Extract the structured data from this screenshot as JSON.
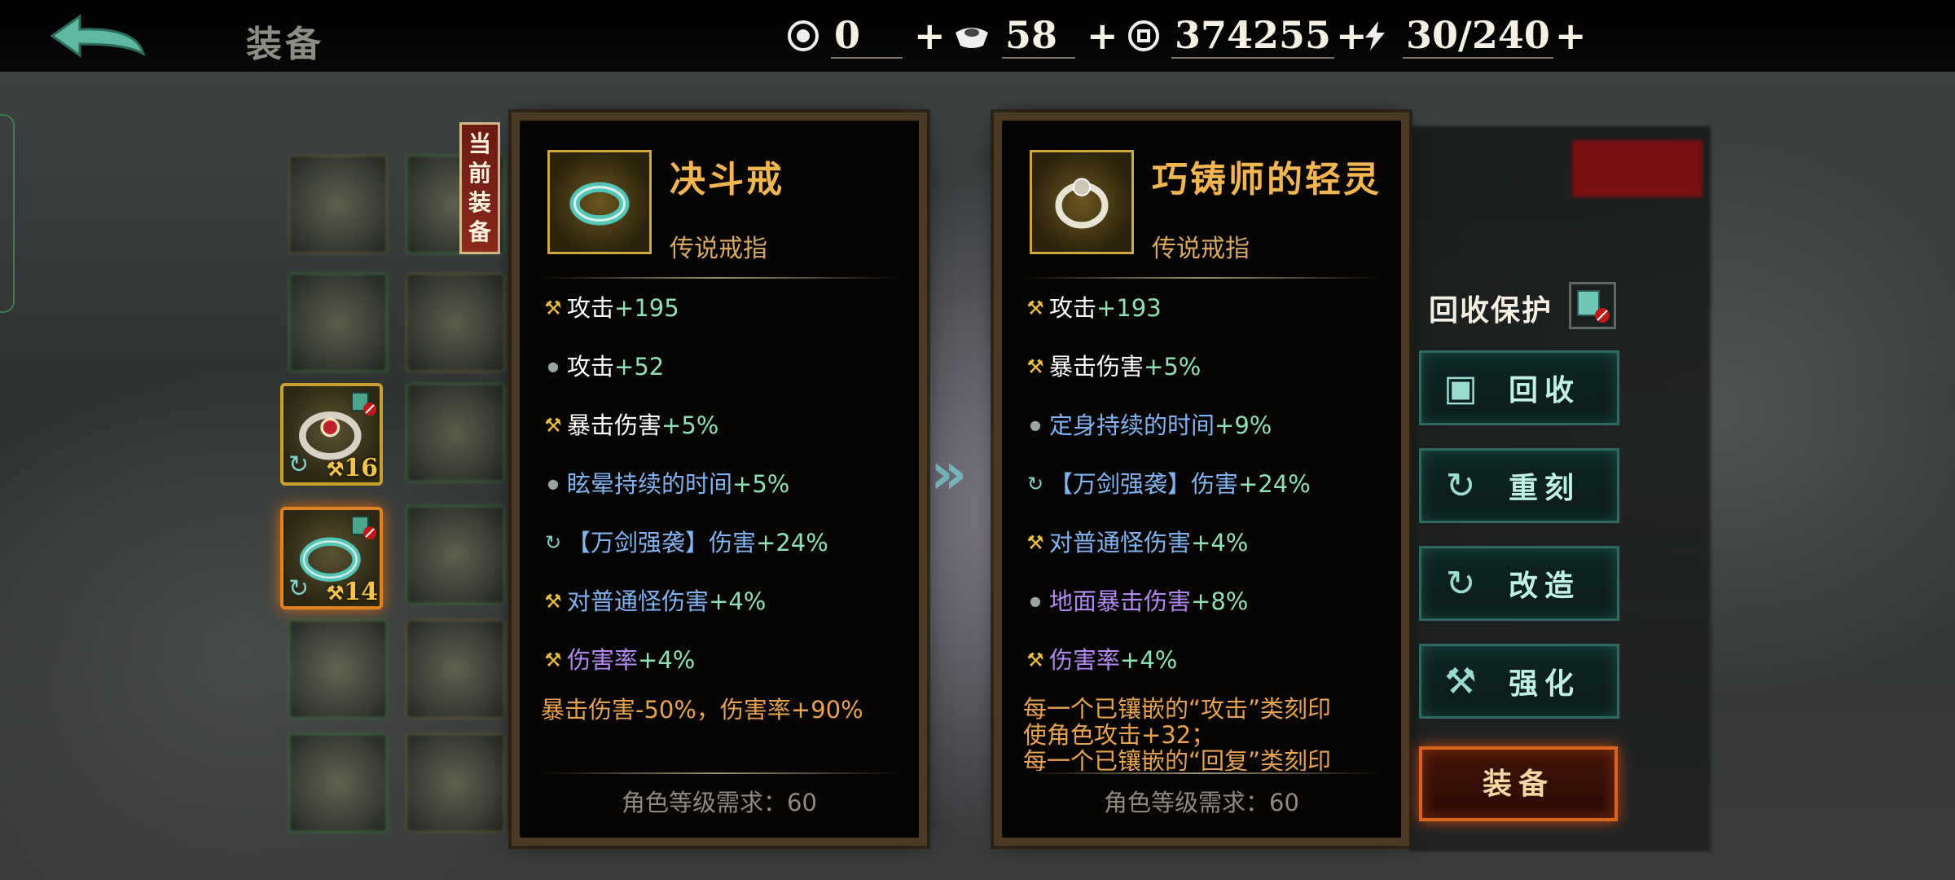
{
  "header": {
    "title": "装备",
    "currencies": [
      {
        "icon": "coupon-icon",
        "value": "0",
        "plus": "+"
      },
      {
        "icon": "silver-ingot-icon",
        "value": "58",
        "plus": "+"
      },
      {
        "icon": "coin-icon",
        "value": "374255",
        "plus": "+"
      },
      {
        "icon": "lightning-icon",
        "value": "30/240",
        "plus": "+"
      }
    ]
  },
  "slots": [
    {
      "level": "16",
      "selected": false
    },
    {
      "level": "14",
      "selected": true
    }
  ],
  "current_tag": "当前装备",
  "current_item": {
    "name": "决斗戒",
    "type": "传说戒指",
    "stats": [
      {
        "marker": "hammer",
        "label": "攻击",
        "value": "+195",
        "label_color": "#ffffff",
        "value_color": "#8fe1b3"
      },
      {
        "marker": "dot",
        "label": "攻击",
        "value": "+52",
        "label_color": "#ffffff",
        "value_color": "#8fe1b3"
      },
      {
        "marker": "hammer",
        "label": "暴击伤害",
        "value": "+5%",
        "label_color": "#ffffff",
        "value_color": "#8fe1b3"
      },
      {
        "marker": "dot",
        "label": "眩晕持续的时间",
        "value": "+5%",
        "label_color": "#7fb3f2",
        "value_color": "#8fe1b3"
      },
      {
        "marker": "cycle",
        "label": "【万剑强袭】伤害",
        "value": "+24%",
        "label_color": "#7fb3f2",
        "value_color": "#8fe1b3"
      },
      {
        "marker": "hammer",
        "label": "对普通怪伤害",
        "value": "+4%",
        "label_color": "#7fb3f2",
        "value_color": "#8fe1b3"
      },
      {
        "marker": "hammer",
        "label": "伤害率",
        "value": "+4%",
        "label_color": "#b08af0",
        "value_color": "#8fe1b3"
      }
    ],
    "note": "暴击伤害-50%，伤害率+90%",
    "requirement": "角色等级需求：60"
  },
  "new_item": {
    "name": "巧铸师的轻灵",
    "type": "传说戒指",
    "stats": [
      {
        "marker": "hammer",
        "label": "攻击",
        "value": "+193",
        "label_color": "#ffffff",
        "value_color": "#8fe1b3"
      },
      {
        "marker": "hammer",
        "label": "暴击伤害",
        "value": "+5%",
        "label_color": "#ffffff",
        "value_color": "#8fe1b3"
      },
      {
        "marker": "dot",
        "label": "定身持续的时间",
        "value": "+9%",
        "label_color": "#7fb3f2",
        "value_color": "#8fe1b3"
      },
      {
        "marker": "cycle",
        "label": "【万剑强袭】伤害",
        "value": "+24%",
        "label_color": "#7fb3f2",
        "value_color": "#8fe1b3"
      },
      {
        "marker": "hammer",
        "label": "对普通怪伤害",
        "value": "+4%",
        "label_color": "#7fb3f2",
        "value_color": "#8fe1b3"
      },
      {
        "marker": "dot",
        "label": "地面暴击伤害",
        "value": "+8%",
        "label_color": "#b08af0",
        "value_color": "#8fe1b3"
      },
      {
        "marker": "hammer",
        "label": "伤害率",
        "value": "+4%",
        "label_color": "#b08af0",
        "value_color": "#8fe1b3"
      }
    ],
    "note_lines": [
      "每一个已镶嵌的“攻击”类刻印",
      "使角色攻击+32；",
      "每一个已镶嵌的“回复”类刻印"
    ],
    "requirement": "角色等级需求：60"
  },
  "actions": {
    "protect_label": "回收保护",
    "buttons": [
      {
        "id": "recycle",
        "icon": "recycle-box-icon",
        "label": "回收"
      },
      {
        "id": "reforge",
        "icon": "refresh-icon",
        "label": "重刻"
      },
      {
        "id": "modify",
        "icon": "refresh-icon",
        "label": "改造"
      },
      {
        "id": "enhance",
        "icon": "hammer-icon",
        "label": "强化"
      }
    ],
    "equip_label": "装备"
  },
  "colors": {
    "accent_gold": "#f2b651",
    "stat_value": "#8fe1b3",
    "blue_stat": "#7fb3f2",
    "purple_stat": "#b08af0",
    "note_orange": "#e7a24e"
  }
}
